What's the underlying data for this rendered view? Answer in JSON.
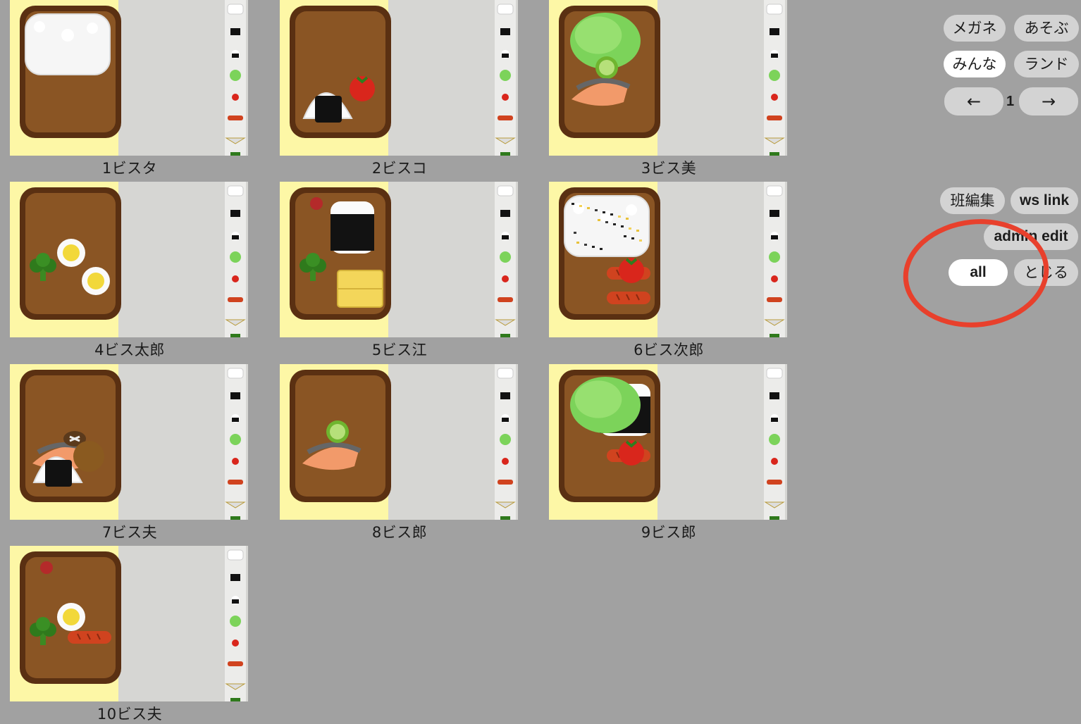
{
  "bentos": [
    {
      "label": "1ビスタ",
      "items": [
        "rice"
      ]
    },
    {
      "label": "2ビスコ",
      "items": [
        "onigiri",
        "tomato"
      ]
    },
    {
      "label": "3ビス美",
      "items": [
        "lettuce",
        "cucumber",
        "salmon"
      ]
    },
    {
      "label": "4ビス太郎",
      "items": [
        "egg",
        "egg2",
        "broccoli"
      ]
    },
    {
      "label": "5ビス江",
      "items": [
        "umeboshi",
        "onigiri-nori",
        "broccoli",
        "tamagoyaki"
      ]
    },
    {
      "label": "6ビス次郎",
      "items": [
        "furikake-rice",
        "sausage",
        "tomato",
        "sausage2"
      ]
    },
    {
      "label": "7ビス夫",
      "items": [
        "salmon",
        "shiitake",
        "karaage",
        "onigiri"
      ]
    },
    {
      "label": "8ビス郎",
      "items": [
        "salmon",
        "cucumber"
      ]
    },
    {
      "label": "9ビス郎",
      "items": [
        "onigiri-nori",
        "onigiri-nori2",
        "lettuce",
        "sausage",
        "tomato"
      ]
    },
    {
      "label": "10ビス夫",
      "items": [
        "umeboshi",
        "egg",
        "broccoli",
        "sausage"
      ]
    }
  ],
  "topbar": {
    "megane": "メガネ",
    "asobu": "あそぶ",
    "minna": "みんな",
    "land": "ランド",
    "prev_icon": "←",
    "page": "1",
    "next_icon": "→"
  },
  "admin": {
    "han_edit": "班編集",
    "ws_link": "ws link",
    "admin_edit": "admin edit",
    "all": "all",
    "close": "とじる"
  },
  "colors": {
    "background": "#a1a1a1",
    "pill": "#d3d3d3",
    "pill_active": "#ffffff",
    "annotation": "#e8402c",
    "bento_box": "#8a5524",
    "bento_rim": "#5a3012"
  }
}
